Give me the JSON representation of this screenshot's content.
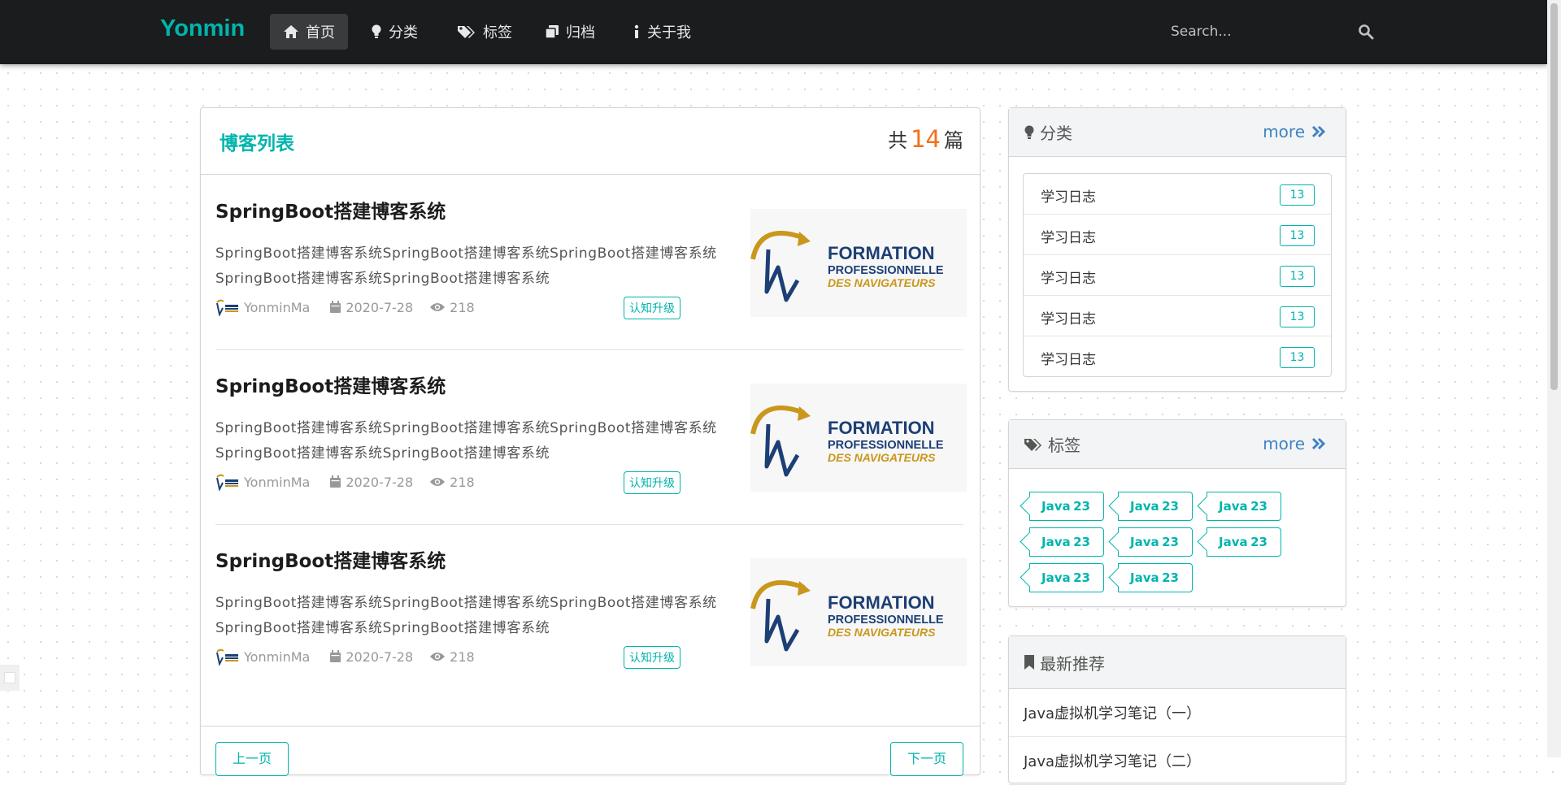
{
  "nav": {
    "brand": "Yonmin",
    "items": [
      {
        "label": "首页",
        "icon": "home-icon",
        "active": true
      },
      {
        "label": "分类",
        "icon": "lightbulb-icon"
      },
      {
        "label": "标签",
        "icon": "tags-icon"
      },
      {
        "label": "归档",
        "icon": "archive-icon"
      },
      {
        "label": "关于我",
        "icon": "info-icon"
      }
    ],
    "search_placeholder": "Search..."
  },
  "main": {
    "title": "博客列表",
    "count_prefix": "共",
    "count": "14",
    "count_suffix": "篇",
    "posts": [
      {
        "title": "SpringBoot搭建博客系统",
        "desc": "SpringBoot搭建博客系统SpringBoot搭建博客系统SpringBoot搭建博客系统SpringBoot搭建博客系统SpringBoot搭建博客系统",
        "author": "YonminMa",
        "date": "2020-7-28",
        "views": "218",
        "tag": "认知升级"
      },
      {
        "title": "SpringBoot搭建博客系统",
        "desc": "SpringBoot搭建博客系统SpringBoot搭建博客系统SpringBoot搭建博客系统SpringBoot搭建博客系统SpringBoot搭建博客系统",
        "author": "YonminMa",
        "date": "2020-7-28",
        "views": "218",
        "tag": "认知升级"
      },
      {
        "title": "SpringBoot搭建博客系统",
        "desc": "SpringBoot搭建博客系统SpringBoot搭建博客系统SpringBoot搭建博客系统SpringBoot搭建博客系统SpringBoot搭建博客系统",
        "author": "YonminMa",
        "date": "2020-7-28",
        "views": "218",
        "tag": "认知升级"
      }
    ],
    "prev_label": "上一页",
    "next_label": "下一页"
  },
  "post_image": {
    "line1": "FORMATION",
    "line2": "PROFESSIONNELLE",
    "line3": "DES NAVIGATEURS"
  },
  "categories": {
    "title": "分类",
    "more": "more",
    "items": [
      {
        "label": "学习日志",
        "count": "13"
      },
      {
        "label": "学习日志",
        "count": "13"
      },
      {
        "label": "学习日志",
        "count": "13"
      },
      {
        "label": "学习日志",
        "count": "13"
      },
      {
        "label": "学习日志",
        "count": "13"
      }
    ]
  },
  "tags": {
    "title": "标签",
    "more": "more",
    "items": [
      {
        "label": "Java",
        "count": "23"
      },
      {
        "label": "Java",
        "count": "23"
      },
      {
        "label": "Java",
        "count": "23"
      },
      {
        "label": "Java",
        "count": "23"
      },
      {
        "label": "Java",
        "count": "23"
      },
      {
        "label": "Java",
        "count": "23"
      },
      {
        "label": "Java",
        "count": "23"
      },
      {
        "label": "Java",
        "count": "23"
      }
    ]
  },
  "recommend": {
    "title": "最新推荐",
    "items": [
      {
        "label": "Java虚拟机学习笔记（一）"
      },
      {
        "label": "Java虚拟机学习笔记（二）"
      }
    ]
  },
  "colors": {
    "accent": "#00b5ad",
    "count_number": "#f2711c",
    "link": "#4183c4",
    "navbar": "#1b1c1d"
  }
}
